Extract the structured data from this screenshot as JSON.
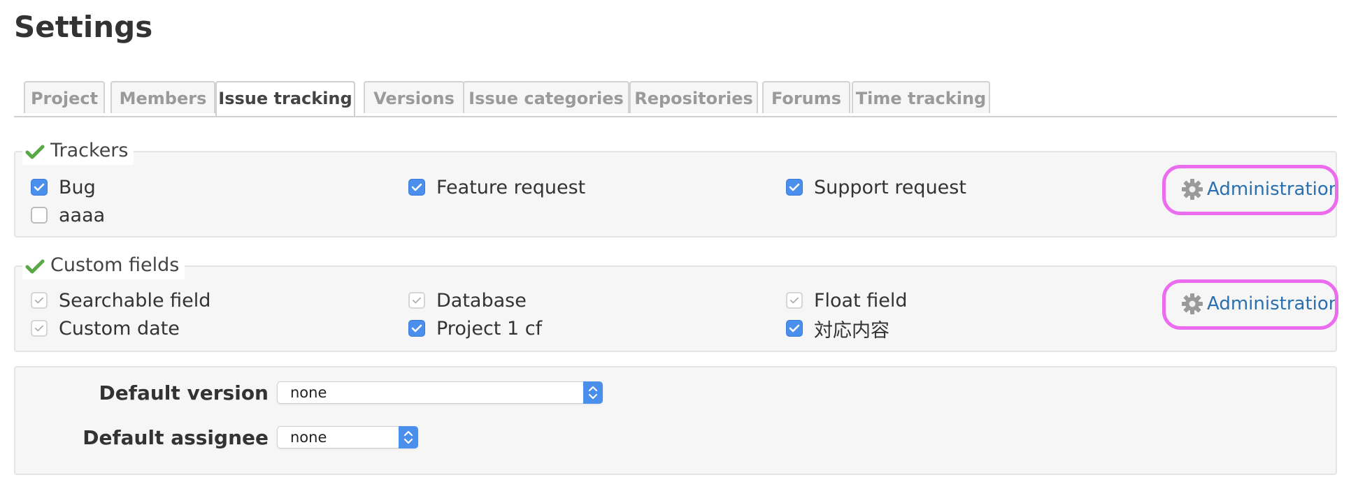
{
  "page": {
    "title": "Settings"
  },
  "tabs": [
    {
      "label": "Project"
    },
    {
      "label": "Members"
    },
    {
      "label": "Issue tracking"
    },
    {
      "label": "Versions"
    },
    {
      "label": "Issue categories"
    },
    {
      "label": "Repositories"
    },
    {
      "label": "Forums"
    },
    {
      "label": "Time tracking"
    }
  ],
  "active_tab": "Issue tracking",
  "trackers": {
    "legend": "Trackers",
    "items": [
      {
        "label": "Bug",
        "checked": true
      },
      {
        "label": "Feature request",
        "checked": true
      },
      {
        "label": "Support request",
        "checked": true
      },
      {
        "label": "aaaa",
        "checked": false
      }
    ],
    "admin_link": "Administration"
  },
  "custom_fields": {
    "legend": "Custom fields",
    "items": [
      {
        "label": "Searchable field",
        "checked": true,
        "disabled": true
      },
      {
        "label": "Database",
        "checked": true,
        "disabled": true
      },
      {
        "label": "Float field",
        "checked": true,
        "disabled": true
      },
      {
        "label": "Custom date",
        "checked": true,
        "disabled": true
      },
      {
        "label": "Project 1 cf",
        "checked": true,
        "disabled": false
      },
      {
        "label": "対応内容",
        "checked": true,
        "disabled": false
      }
    ],
    "admin_link": "Administration"
  },
  "defaults": {
    "version_label": "Default version",
    "version_value": "none",
    "assignee_label": "Default assignee",
    "assignee_value": "none"
  },
  "colors": {
    "link": "#2a6fb0",
    "checkbox_checked": "#4a8fec",
    "highlight": "#ec6cf0",
    "legend_check": "#5aa845"
  },
  "icons": {
    "legend": "check-icon",
    "admin": "gear-icon",
    "select": "chevron-up-down-icon"
  }
}
